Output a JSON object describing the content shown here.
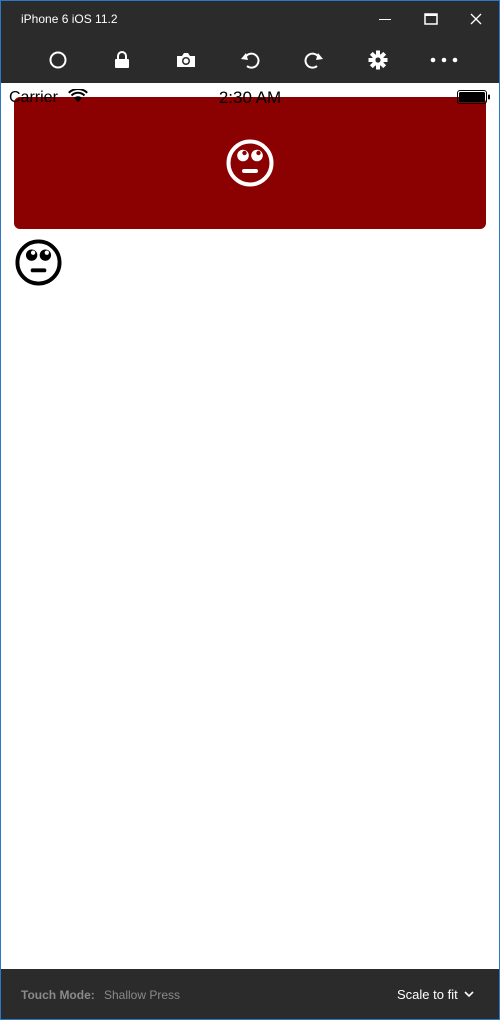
{
  "window": {
    "title": "iPhone 6 iOS 11.2"
  },
  "toolbar": {
    "icons": [
      "home-icon",
      "lock-icon",
      "camera-icon",
      "rotate-left-icon",
      "rotate-right-icon",
      "gear-icon",
      "more-icon"
    ]
  },
  "device": {
    "status": {
      "carrier": "Carrier",
      "time": "2:30 AM"
    },
    "button": {
      "background": "#8b0000",
      "icon": "eye-roll-face-icon",
      "icon_color": "#ffffff"
    },
    "face_icon": "eye-roll-face-icon"
  },
  "bottom": {
    "touch_mode_label": "Touch Mode:",
    "touch_mode_value": "Shallow Press",
    "scale": "Scale to fit"
  }
}
